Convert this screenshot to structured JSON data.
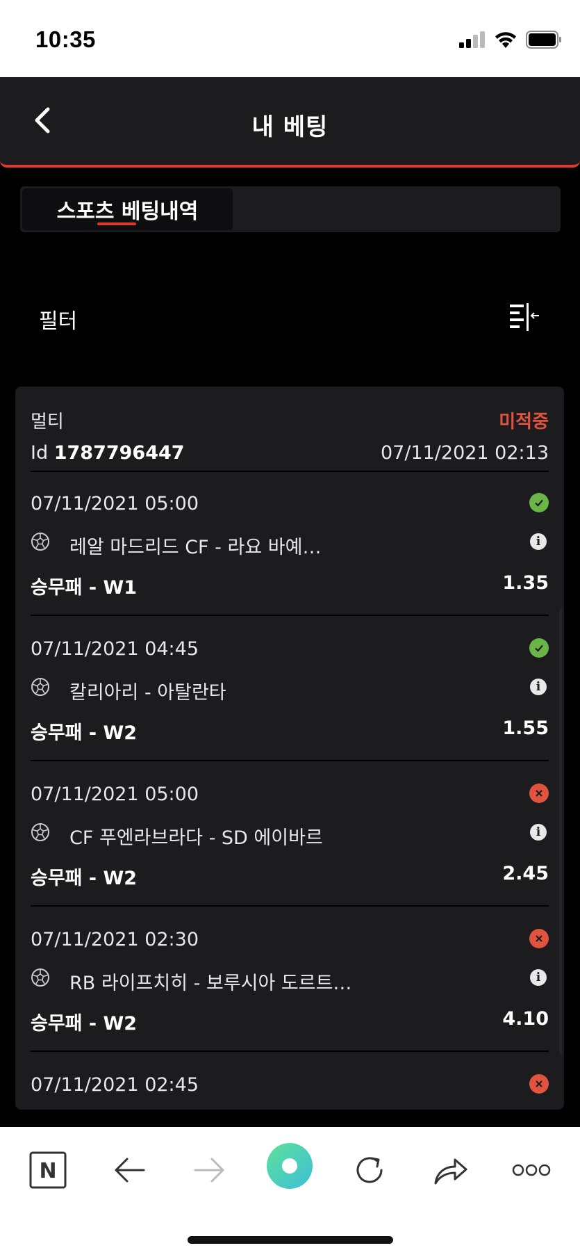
{
  "status_bar": {
    "time": "10:35"
  },
  "header": {
    "title": "내 베팅"
  },
  "tabs": [
    {
      "label": "스포츠 베팅내역",
      "active": true
    }
  ],
  "filter": {
    "label": "필터"
  },
  "bet": {
    "type": "멀티",
    "status": "미적중",
    "id_label": "Id",
    "id_value": "1787796447",
    "placed_at": "07/11/2021 02:13",
    "selections": [
      {
        "time": "07/11/2021 05:00",
        "result": "won",
        "match": "레알 마드리드 CF - 라요 바예…",
        "market": "승무패 - W1",
        "odds": "1.35"
      },
      {
        "time": "07/11/2021 04:45",
        "result": "won",
        "match": "칼리아리 - 아탈란타",
        "market": "승무패 - W2",
        "odds": "1.55"
      },
      {
        "time": "07/11/2021 05:00",
        "result": "lost",
        "match": "CF 푸엔라브라다 - SD 에이바르",
        "market": "승무패 - W2",
        "odds": "2.45"
      },
      {
        "time": "07/11/2021 02:30",
        "result": "lost",
        "match": "RB 라이프치히 - 보루시아 도르트…",
        "market": "승무패 - W2",
        "odds": "4.10"
      },
      {
        "time": "07/11/2021 02:45",
        "result": "lost"
      }
    ]
  },
  "colors": {
    "accent": "#e03a2c",
    "won": "#69b548",
    "lost": "#e0543f",
    "surface": "#1c1c1f"
  }
}
